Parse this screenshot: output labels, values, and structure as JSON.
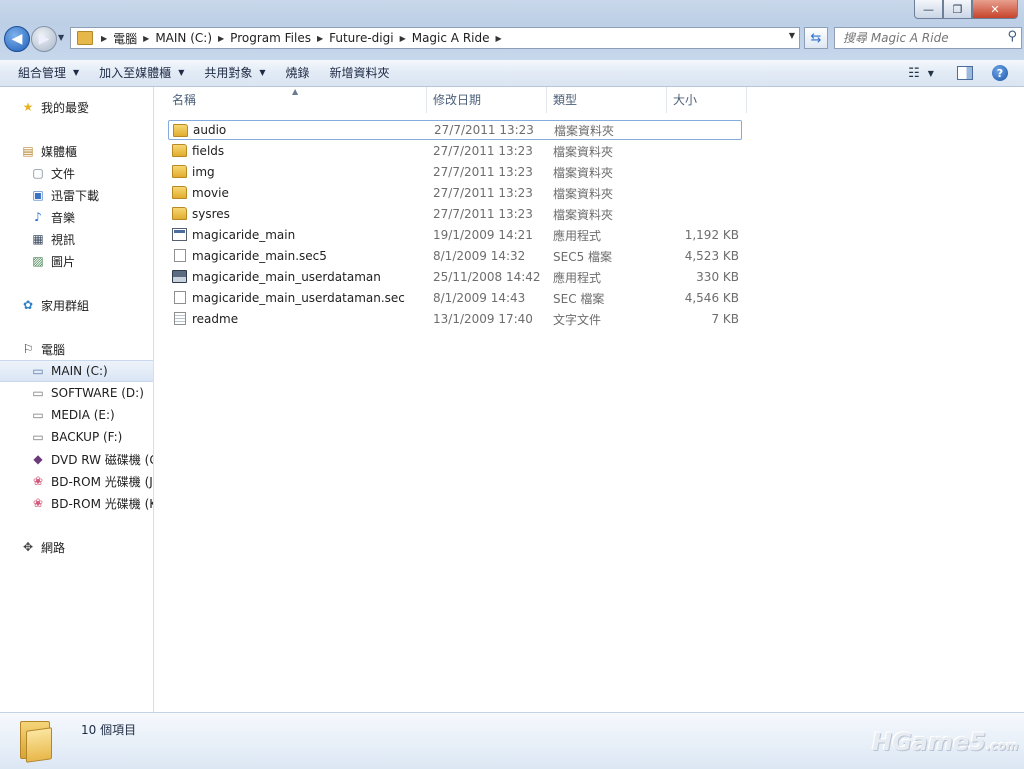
{
  "window": {
    "controls": {
      "minimize": "—",
      "maximize": "❐",
      "close": "✕"
    }
  },
  "address": {
    "crumbs": [
      "電腦",
      "MAIN (C:)",
      "Program Files",
      "Future-digi",
      "Magic A Ride"
    ]
  },
  "search": {
    "placeholder": "搜尋 Magic A Ride"
  },
  "toolbar": {
    "organize": "組合管理",
    "include_library": "加入至媒體櫃",
    "share": "共用對象",
    "burn": "燒錄",
    "new_folder": "新增資料夾"
  },
  "nav": {
    "favorites": "我的最愛",
    "libraries": "媒體櫃",
    "documents": "文件",
    "thunder": "迅雷下載",
    "music": "音樂",
    "videos": "視訊",
    "pictures": "圖片",
    "homegroup": "家用群組",
    "computer": "電腦",
    "drive_c": "MAIN (C:)",
    "drive_d": "SOFTWARE (D:)",
    "drive_e": "MEDIA (E:)",
    "drive_f": "BACKUP (F:)",
    "drive_g": "DVD RW 磁碟機 (G",
    "drive_j": "BD-ROM 光碟機 (J",
    "drive_k": "BD-ROM 光碟機 (K",
    "network": "網路"
  },
  "columns": {
    "name": "名稱",
    "date": "修改日期",
    "type": "類型",
    "size": "大小"
  },
  "files": [
    {
      "name": "audio",
      "date": "27/7/2011 13:23",
      "type": "檔案資料夾",
      "size": "",
      "icon": "folder-icon"
    },
    {
      "name": "fields",
      "date": "27/7/2011 13:23",
      "type": "檔案資料夾",
      "size": "",
      "icon": "folder-icon"
    },
    {
      "name": "img",
      "date": "27/7/2011 13:23",
      "type": "檔案資料夾",
      "size": "",
      "icon": "folder-icon"
    },
    {
      "name": "movie",
      "date": "27/7/2011 13:23",
      "type": "檔案資料夾",
      "size": "",
      "icon": "folder-icon"
    },
    {
      "name": "sysres",
      "date": "27/7/2011 13:23",
      "type": "檔案資料夾",
      "size": "",
      "icon": "folder-icon"
    },
    {
      "name": "magicaride_main",
      "date": "19/1/2009 14:21",
      "type": "應用程式",
      "size": "1,192 KB",
      "icon": "application-icon"
    },
    {
      "name": "magicaride_main.sec5",
      "date": "8/1/2009 14:32",
      "type": "SEC5 檔案",
      "size": "4,523 KB",
      "icon": "file-icon"
    },
    {
      "name": "magicaride_main_userdataman",
      "date": "25/11/2008 14:42",
      "type": "應用程式",
      "size": "330 KB",
      "icon": "floppy-disk-icon"
    },
    {
      "name": "magicaride_main_userdataman.sec",
      "date": "8/1/2009 14:43",
      "type": "SEC 檔案",
      "size": "4,546 KB",
      "icon": "file-icon"
    },
    {
      "name": "readme",
      "date": "13/1/2009 17:40",
      "type": "文字文件",
      "size": "7 KB",
      "icon": "text-file-icon"
    }
  ],
  "status": {
    "count": "10 個項目"
  },
  "watermark": {
    "text": "HGame5",
    "suffix": ".com"
  },
  "colors": {
    "selection_border": "#84acdd",
    "toolbar_bg": "#dbe5f2"
  }
}
